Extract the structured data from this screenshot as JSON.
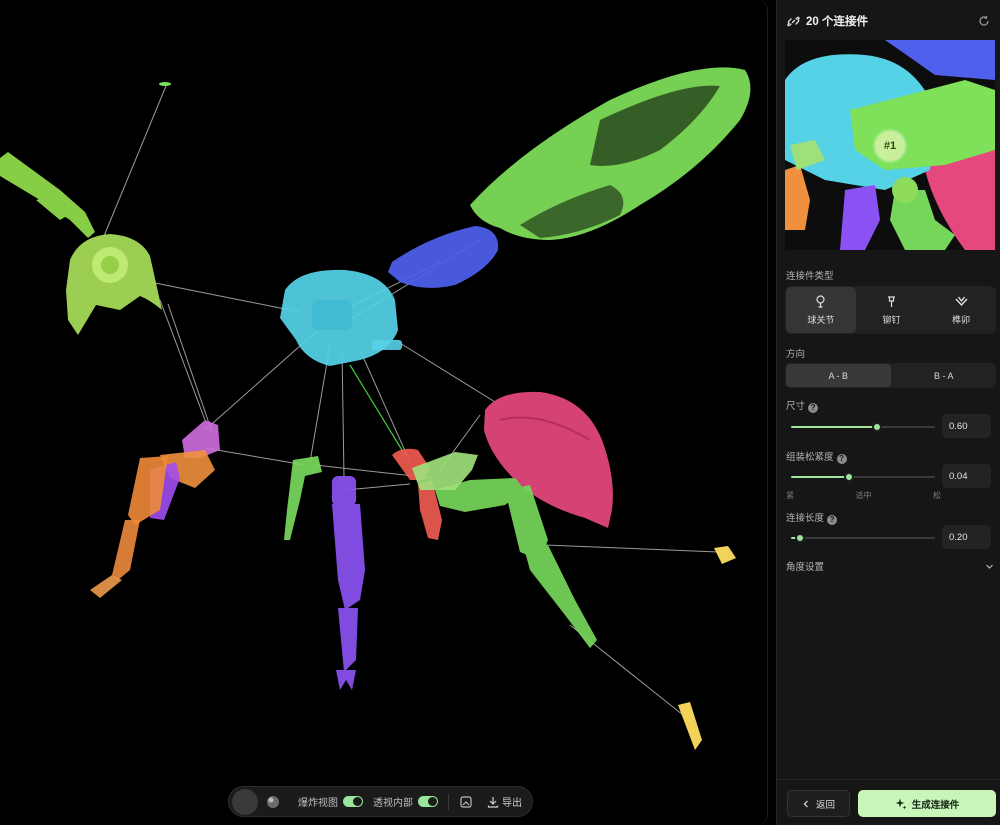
{
  "viewport": {
    "toolbar": {
      "exploded_view_label": "爆炸视图",
      "xray_label": "透视内部",
      "export_label": "导出"
    }
  },
  "panel": {
    "title": "20 个连接件",
    "preview_badge": "#1",
    "connector_type_label": "连接件类型",
    "types": [
      {
        "label": "球关节",
        "icon": "ball-joint-icon",
        "active": true
      },
      {
        "label": "铆钉",
        "icon": "rivet-icon",
        "active": false
      },
      {
        "label": "榫卯",
        "icon": "mortise-icon",
        "active": false
      }
    ],
    "direction_label": "方向",
    "directions": [
      {
        "label": "A - B",
        "active": true
      },
      {
        "label": "B - A",
        "active": false
      }
    ],
    "size": {
      "label": "尺寸",
      "value": "0.60",
      "fraction": 0.6
    },
    "tightness": {
      "label": "组装松紧度",
      "value": "0.04",
      "fraction": 0.4,
      "ticks": [
        "紧",
        "适中",
        "松"
      ]
    },
    "length": {
      "label": "连接长度",
      "value": "0.20",
      "fraction": 0.06
    },
    "angle_label": "角度设置",
    "back_label": "返回",
    "generate_label": "生成连接件"
  },
  "colors": {
    "accent": "#9fe49f",
    "green": "#7ee25c",
    "cyan": "#52d3e6",
    "blue": "#4a5ee8",
    "purple": "#8a50f0",
    "orange": "#ef8a3a",
    "pink": "#e2457a",
    "red": "#ef5a4f",
    "lime": "#b7e05a",
    "yellow": "#f3d25a"
  }
}
